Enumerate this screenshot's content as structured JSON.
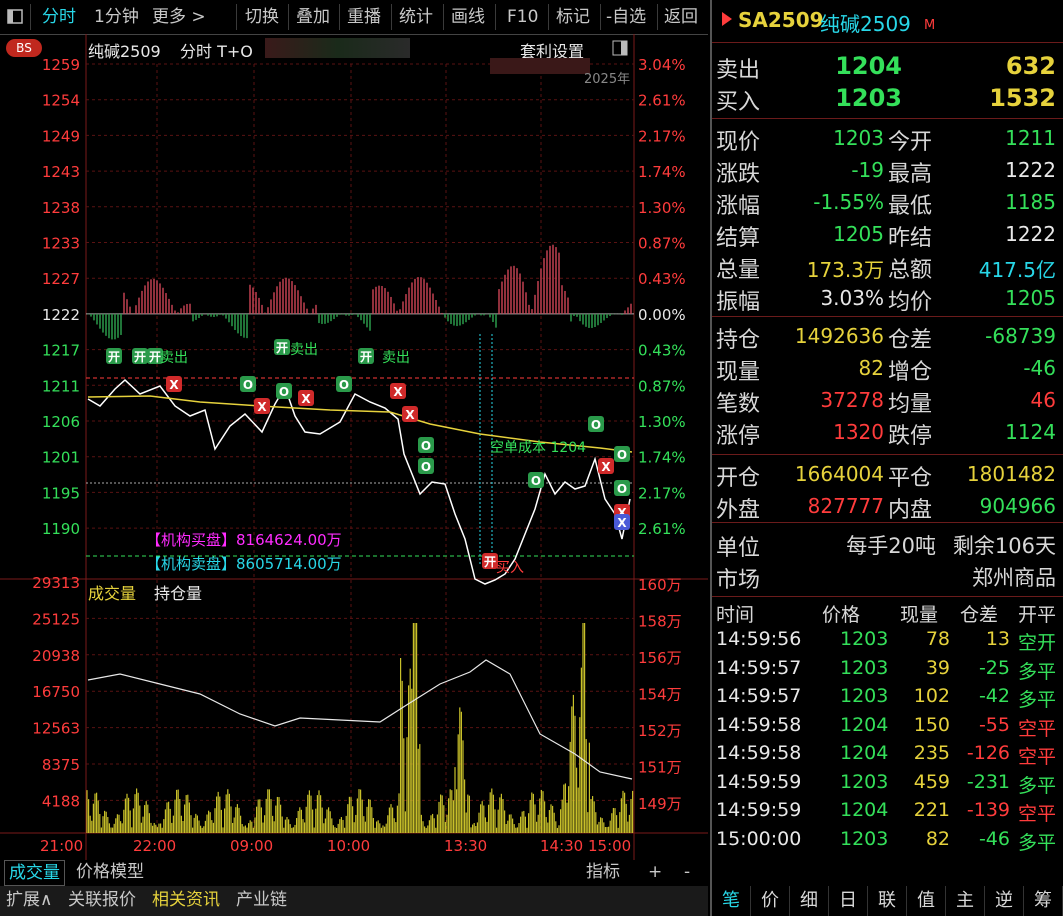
{
  "toolbar": {
    "items": [
      "分时",
      "1分钟",
      "更多 >",
      "切换",
      "叠加",
      "重播",
      "统计",
      "画线",
      "F10",
      "标记",
      "-自选",
      "返回"
    ],
    "window_icon": "window-icon"
  },
  "chart_header": {
    "bs_badge": "BS",
    "symbol": "纯碱2509",
    "mode": "分时 T+O",
    "settings": "套利设置",
    "date_fragment": "2025年"
  },
  "price_axis_left": [
    "1259",
    "1254",
    "1249",
    "1243",
    "1238",
    "1233",
    "1227",
    "1222",
    "1217",
    "1211",
    "1206",
    "1201",
    "1195",
    "1190"
  ],
  "pct_axis_right": [
    "3.04%",
    "2.61%",
    "2.17%",
    "1.74%",
    "1.30%",
    "0.87%",
    "0.43%",
    "0.00%",
    "0.43%",
    "0.87%",
    "1.30%",
    "1.74%",
    "2.17%",
    "2.61%"
  ],
  "annotations": {
    "buy_order": "【机构买盘】8164624.00万",
    "sell_order": "【机构卖盘】8605714.00万",
    "cost_line": "空单成本 1204",
    "sell_tag": "卖出",
    "buy_tag": "买入"
  },
  "volume_header": {
    "vol_label": "成交量",
    "oi_label": "持仓量"
  },
  "volume_axis_left": [
    "29313",
    "25125",
    "20938",
    "16750",
    "12563",
    "8375",
    "4188"
  ],
  "oi_axis_right": [
    "160万",
    "158万",
    "156万",
    "154万",
    "152万",
    "151万",
    "149万"
  ],
  "time_axis": [
    "21:00",
    "22:00",
    "09:00",
    "10:00",
    "13:30",
    "14:30",
    "15:00"
  ],
  "bottom_tabs": {
    "tab1": "成交量",
    "tab2": "价格模型",
    "indicator": "指标",
    "plus": "+",
    "minus": "-"
  },
  "bottom_bar": [
    "扩展∧",
    "关联报价",
    "相关资讯",
    "产业链"
  ],
  "quote": {
    "code": "SA2509",
    "name": "纯碱2509",
    "market_flag": "M",
    "sell_label": "卖出",
    "sell_price": "1204",
    "sell_vol": "632",
    "buy_label": "买入",
    "buy_price": "1203",
    "buy_vol": "1532",
    "fields": [
      {
        "l1": "现价",
        "v1": "1203",
        "c1": "green",
        "l2": "今开",
        "v2": "1211",
        "c2": "green"
      },
      {
        "l1": "涨跌",
        "v1": "-19",
        "c1": "green",
        "l2": "最高",
        "v2": "1222",
        "c2": "white"
      },
      {
        "l1": "涨幅",
        "v1": "-1.55%",
        "c1": "green",
        "l2": "最低",
        "v2": "1185",
        "c2": "green"
      },
      {
        "l1": "结算",
        "v1": "1205",
        "c1": "green",
        "l2": "昨结",
        "v2": "1222",
        "c2": "white"
      },
      {
        "l1": "总量",
        "v1": "173.3万",
        "c1": "yellow",
        "l2": "总额",
        "v2": "417.5亿",
        "c2": "cyan"
      },
      {
        "l1": "振幅",
        "v1": "3.03%",
        "c1": "white",
        "l2": "均价",
        "v2": "1205",
        "c2": "green"
      }
    ],
    "fields2": [
      {
        "l1": "持仓",
        "v1": "1492636",
        "c1": "yellow",
        "l2": "仓差",
        "v2": "-68739",
        "c2": "green"
      },
      {
        "l1": "现量",
        "v1": "82",
        "c1": "yellow",
        "l2": "增仓",
        "v2": "-46",
        "c2": "green"
      },
      {
        "l1": "笔数",
        "v1": "37278",
        "c1": "red",
        "l2": "均量",
        "v2": "46",
        "c2": "red"
      },
      {
        "l1": "涨停",
        "v1": "1320",
        "c1": "red",
        "l2": "跌停",
        "v2": "1124",
        "c2": "green"
      }
    ],
    "fields3": [
      {
        "l1": "开仓",
        "v1": "1664004",
        "c1": "yellow",
        "l2": "平仓",
        "v2": "1801482",
        "c2": "yellow"
      },
      {
        "l1": "外盘",
        "v1": "827777",
        "c1": "red",
        "l2": "内盘",
        "v2": "904966",
        "c2": "green"
      }
    ],
    "unit_label": "单位",
    "unit_value": "每手20吨",
    "remaining": "剩余106天",
    "market_label": "市场",
    "market_value": "郑州商品"
  },
  "ticks": {
    "headers": [
      "时间",
      "价格",
      "现量",
      "仓差",
      "开平"
    ],
    "rows": [
      {
        "time": "14:59:56",
        "price": "1203",
        "vol": "78",
        "oi": "13",
        "type": "空开",
        "pc": "green",
        "oc": "yellow",
        "tc": "green"
      },
      {
        "time": "14:59:57",
        "price": "1203",
        "vol": "39",
        "oi": "-25",
        "type": "多平",
        "pc": "green",
        "oc": "green",
        "tc": "green"
      },
      {
        "time": "14:59:57",
        "price": "1203",
        "vol": "102",
        "oi": "-42",
        "type": "多平",
        "pc": "green",
        "oc": "green",
        "tc": "green"
      },
      {
        "time": "14:59:58",
        "price": "1204",
        "vol": "150",
        "oi": "-55",
        "type": "空平",
        "pc": "green",
        "oc": "red",
        "tc": "red"
      },
      {
        "time": "14:59:58",
        "price": "1204",
        "vol": "235",
        "oi": "-126",
        "type": "空平",
        "pc": "green",
        "oc": "red",
        "tc": "red"
      },
      {
        "time": "14:59:59",
        "price": "1203",
        "vol": "459",
        "oi": "-231",
        "type": "多平",
        "pc": "green",
        "oc": "green",
        "tc": "green"
      },
      {
        "time": "14:59:59",
        "price": "1204",
        "vol": "221",
        "oi": "-139",
        "type": "空平",
        "pc": "green",
        "oc": "red",
        "tc": "red"
      },
      {
        "time": "15:00:00",
        "price": "1203",
        "vol": "82",
        "oi": "-46",
        "type": "多平",
        "pc": "green",
        "oc": "green",
        "tc": "green"
      }
    ]
  },
  "right_tabs": [
    "笔",
    "价",
    "细",
    "日",
    "联",
    "值",
    "主",
    "逆",
    "筹"
  ],
  "colors": {
    "up": "#ff3c3c",
    "down": "#34e05a",
    "price_line": "#ffffff",
    "avg_line": "#e6d23c",
    "volume": "#e6d23c"
  }
}
